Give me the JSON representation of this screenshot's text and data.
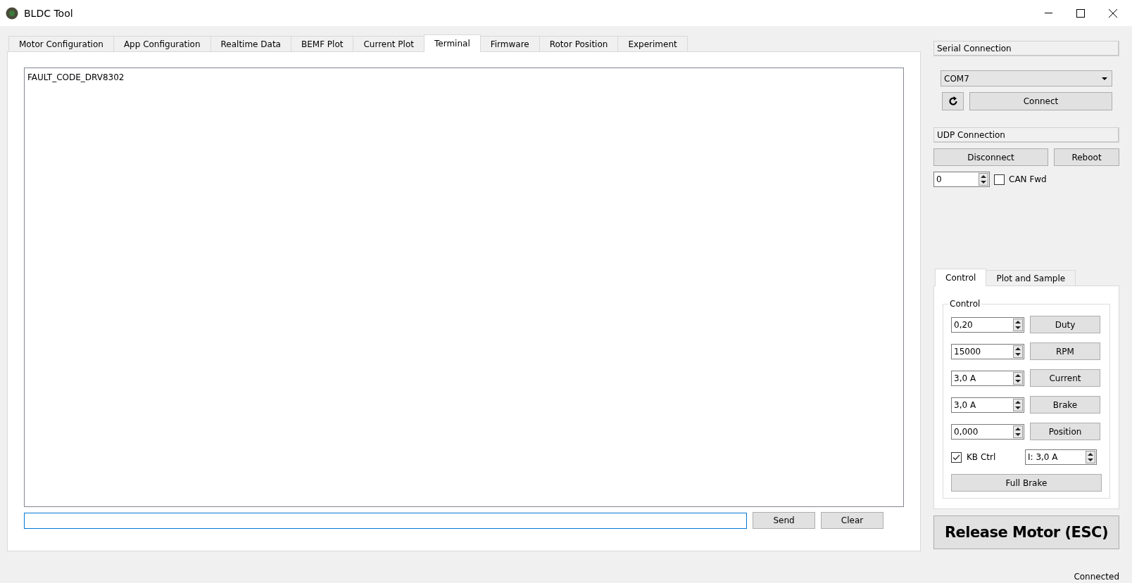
{
  "window": {
    "title": "BLDC Tool"
  },
  "tabs": [
    {
      "label": "Motor Configuration",
      "selected": false
    },
    {
      "label": "App Configuration",
      "selected": false
    },
    {
      "label": "Realtime Data",
      "selected": false
    },
    {
      "label": "BEMF Plot",
      "selected": false
    },
    {
      "label": "Current Plot",
      "selected": false
    },
    {
      "label": "Terminal",
      "selected": true
    },
    {
      "label": "Firmware",
      "selected": false
    },
    {
      "label": "Rotor Position",
      "selected": false
    },
    {
      "label": "Experiment",
      "selected": false
    }
  ],
  "terminal": {
    "output": [
      "FAULT_CODE_DRV8302"
    ],
    "buttons": [
      "Send",
      "Clear"
    ]
  },
  "serial_connection": {
    "header": "Serial Connection",
    "port": "COM7",
    "connect": "Connect"
  },
  "udp_connection": {
    "header": "UDP Connection",
    "disconnect": "Disconnect",
    "reboot": "Reboot",
    "can_id": "0",
    "can_fwd": {
      "label": "CAN Fwd",
      "checked": false
    }
  },
  "control_tabs": [
    {
      "label": "Control",
      "selected": true
    },
    {
      "label": "Plot and Sample",
      "selected": false
    }
  ],
  "control": {
    "title": "Control",
    "rows": [
      {
        "value": "0,20",
        "button": "Duty"
      },
      {
        "value": "15000",
        "button": "RPM"
      },
      {
        "value": "3,0 A",
        "button": "Current"
      },
      {
        "value": "3,0 A",
        "button": "Brake"
      },
      {
        "value": "0,000",
        "button": "Position"
      }
    ],
    "kb_ctrl": {
      "label": "KB Ctrl",
      "checked": true
    },
    "kb_current": "I: 3,0 A",
    "full_brake": "Full Brake"
  },
  "release_button": "Release Motor (ESC)",
  "status_bar": "Connected"
}
